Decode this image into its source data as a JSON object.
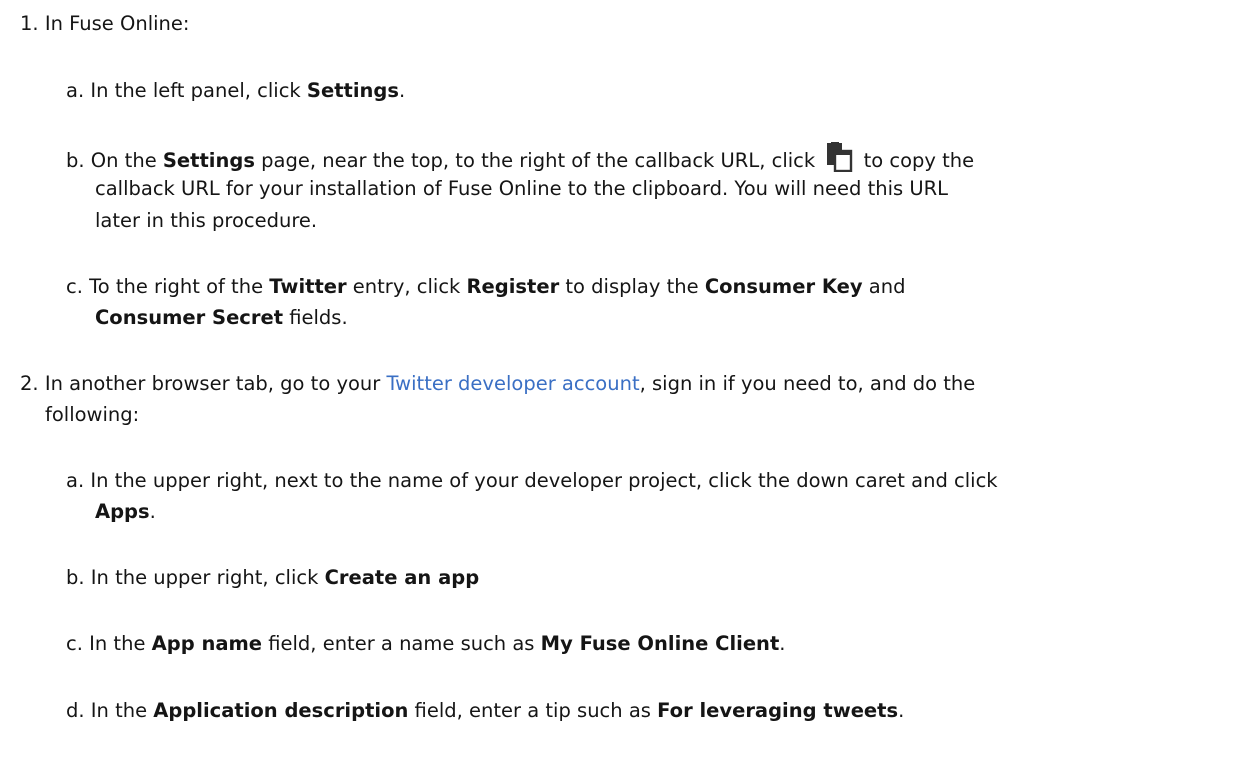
{
  "step1": {
    "num": "1.",
    "intro": "In Fuse Online:",
    "a": {
      "letter": "a.",
      "t1": "In the left panel, click ",
      "b1": "Settings",
      "t2": "."
    },
    "b": {
      "letter": "b.",
      "t1": "On the ",
      "b1": "Settings",
      "t2": " page, near the top, to the right of the callback URL, click ",
      "t3": " to copy the",
      "line2": "callback URL for your installation of Fuse Online to the clipboard. You will need this URL",
      "line3": "later in this procedure.",
      "icon": "copy-icon"
    },
    "c": {
      "letter": "c.",
      "t1": "To the right of the ",
      "b1": "Twitter",
      "t2": " entry, click ",
      "b2": "Register",
      "t3": " to display the ",
      "b3": "Consumer Key",
      "t4": " and",
      "b4": "Consumer Secret",
      "t5": " fields."
    }
  },
  "step2": {
    "num": "2.",
    "t1": "In another browser tab, go to your ",
    "link": "Twitter developer account",
    "t2": ", sign in if you need to, and do the",
    "line2": "following:",
    "a": {
      "letter": "a.",
      "t1": "In the upper right, next to the name of your developer project, click the down caret and click",
      "b1": "Apps",
      "t2": "."
    },
    "b": {
      "letter": "b.",
      "t1": "In the upper right, click ",
      "b1": "Create an app"
    },
    "c": {
      "letter": "c.",
      "t1": "In the ",
      "b1": "App name",
      "t2": " field, enter a name such as ",
      "b2": "My Fuse Online Client",
      "t3": "."
    },
    "d": {
      "letter": "d.",
      "t1": "In the ",
      "b1": "Application description",
      "t2": " field, enter a tip such as ",
      "b2": "For leveraging tweets",
      "t3": "."
    }
  },
  "colors": {
    "text": "#151515",
    "link": "#3a6fc4",
    "icon": "#333333"
  }
}
